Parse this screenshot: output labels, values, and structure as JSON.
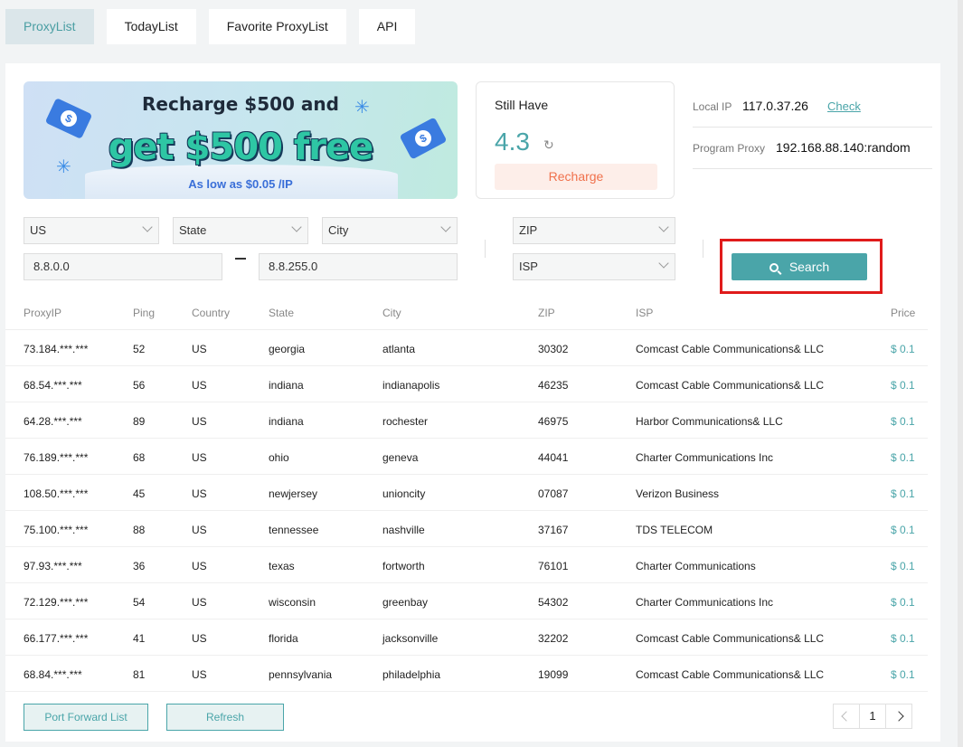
{
  "tabs": [
    {
      "label": "ProxyList"
    },
    {
      "label": "TodayList"
    },
    {
      "label": "Favorite ProxyList"
    },
    {
      "label": "API"
    }
  ],
  "banner": {
    "line1": "Recharge $500 and",
    "line2": "get $500 free",
    "line3": "As low as $0.05 /IP"
  },
  "balance": {
    "label": "Still Have",
    "value": "4.3",
    "recharge_label": "Recharge"
  },
  "info": {
    "local_ip_label": "Local IP",
    "local_ip": "117.0.37.26",
    "check_label": "Check",
    "program_proxy_label": "Program Proxy",
    "program_proxy": "192.168.88.140:random"
  },
  "filters": {
    "country": "US",
    "state": "State",
    "city": "City",
    "zip": "ZIP",
    "isp": "ISP",
    "ip_from": "8.8.0.0",
    "ip_to": "8.8.255.0",
    "search_label": "Search"
  },
  "table": {
    "headers": [
      "ProxyIP",
      "Ping",
      "Country",
      "State",
      "City",
      "ZIP",
      "ISP",
      "Price"
    ],
    "rows": [
      [
        "73.184.***.***",
        "52",
        "US",
        "georgia",
        "atlanta",
        "30302",
        "Comcast Cable Communications& LLC",
        "$ 0.1"
      ],
      [
        "68.54.***.***",
        "56",
        "US",
        "indiana",
        "indianapolis",
        "46235",
        "Comcast Cable Communications& LLC",
        "$ 0.1"
      ],
      [
        "64.28.***.***",
        "89",
        "US",
        "indiana",
        "rochester",
        "46975",
        "Harbor Communications& LLC",
        "$ 0.1"
      ],
      [
        "76.189.***.***",
        "68",
        "US",
        "ohio",
        "geneva",
        "44041",
        "Charter Communications Inc",
        "$ 0.1"
      ],
      [
        "108.50.***.***",
        "45",
        "US",
        "newjersey",
        "unioncity",
        "07087",
        "Verizon Business",
        "$ 0.1"
      ],
      [
        "75.100.***.***",
        "88",
        "US",
        "tennessee",
        "nashville",
        "37167",
        "TDS TELECOM",
        "$ 0.1"
      ],
      [
        "97.93.***.***",
        "36",
        "US",
        "texas",
        "fortworth",
        "76101",
        "Charter Communications",
        "$ 0.1"
      ],
      [
        "72.129.***.***",
        "54",
        "US",
        "wisconsin",
        "greenbay",
        "54302",
        "Charter Communications Inc",
        "$ 0.1"
      ],
      [
        "66.177.***.***",
        "41",
        "US",
        "florida",
        "jacksonville",
        "32202",
        "Comcast Cable Communications& LLC",
        "$ 0.1"
      ],
      [
        "68.84.***.***",
        "81",
        "US",
        "pennsylvania",
        "philadelphia",
        "19099",
        "Comcast Cable Communications& LLC",
        "$ 0.1"
      ]
    ]
  },
  "footer": {
    "port_forward_label": "Port Forward List",
    "refresh_label": "Refresh",
    "current_page": "1"
  }
}
